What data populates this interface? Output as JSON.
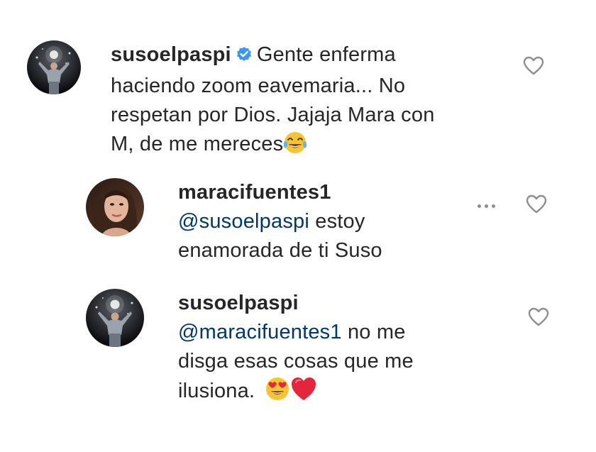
{
  "comments": [
    {
      "username": "susoelpaspi",
      "verified": true,
      "text_line1": "Gente enferma",
      "text_line2": "haciendo zoom eavemaria... No",
      "text_line3": "respetan por Dios. Jajaja Mara con",
      "text_line4": "M, de me mereces",
      "emoji": "face-with-tears-of-joy-emoji",
      "like_icon": "heart-outline-icon"
    },
    {
      "username": "maracifuentes1",
      "mention": "@susoelpaspi",
      "text_line1": " estoy",
      "text_line2": "enamorada de ti Suso",
      "like_icon": "heart-outline-icon",
      "more_icon": "more-options-icon"
    },
    {
      "username": "susoelpaspi",
      "mention": "@maracifuentes1",
      "text_line1": " no me",
      "text_line2": "disga esas cosas que me",
      "text_line3": "ilusiona.",
      "emojis": [
        "smiling-face-with-heart-eyes-emoji",
        "red-heart-emoji"
      ],
      "like_icon": "heart-outline-icon"
    }
  ],
  "colors": {
    "text": "#262626",
    "mention": "#00376b",
    "verified_badge": "#3897f0",
    "icon_gray": "#8e8e8e"
  }
}
